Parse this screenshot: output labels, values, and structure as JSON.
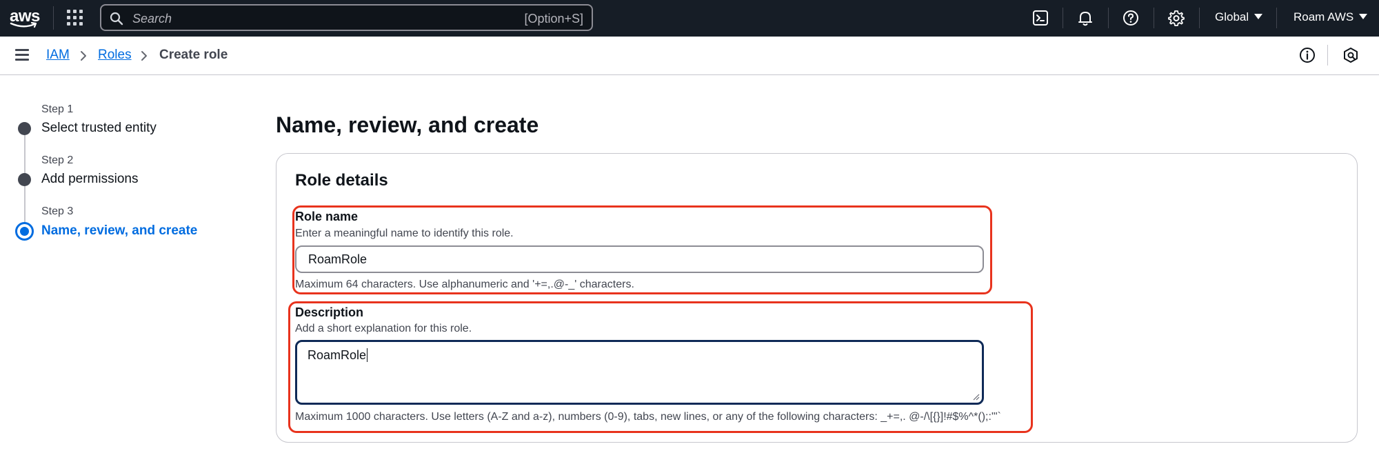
{
  "topnav": {
    "logo_text": "aws",
    "logo_icon": "aws-smile-logo",
    "apps_icon": "grid-icon",
    "search": {
      "placeholder": "Search",
      "shortcut": "[Option+S]",
      "icon": "search-icon"
    },
    "icons": [
      "cloudshell-icon",
      "bell-icon",
      "help-icon",
      "gear-icon"
    ],
    "region_label": "Global",
    "account_label": "Roam AWS",
    "colors": {
      "background": "#161d26",
      "text": "#ffffff"
    }
  },
  "breadcrumb": {
    "items": [
      {
        "label": "IAM",
        "link": true
      },
      {
        "label": "Roles",
        "link": true
      },
      {
        "label": "Create role",
        "link": false
      }
    ],
    "util_icons": [
      "info-icon",
      "settings-hex-icon"
    ]
  },
  "wizard": {
    "steps": [
      {
        "number": "Step 1",
        "title": "Select trusted entity",
        "active": false
      },
      {
        "number": "Step 2",
        "title": "Add permissions",
        "active": false
      },
      {
        "number": "Step 3",
        "title": "Name, review, and create",
        "active": true
      }
    ]
  },
  "main": {
    "title": "Name, review, and create",
    "panel_title": "Role details",
    "role_name": {
      "label": "Role name",
      "description": "Enter a meaningful name to identify this role.",
      "value": "RoamRole",
      "constraint": "Maximum 64 characters. Use alphanumeric and '+=,.@-_' characters."
    },
    "description_field": {
      "label": "Description",
      "description": "Add a short explanation for this role.",
      "value": "RoamRole",
      "constraint": "Maximum 1000 characters. Use letters (A-Z and a-z), numbers (0-9), tabs, new lines, or any of the following characters: _+=,. @-/\\[{}]!#$%^*();:\"'`"
    }
  },
  "colors": {
    "accent": "#006ce0",
    "highlight": "#e8331d",
    "focus_border": "#0f2a57"
  }
}
